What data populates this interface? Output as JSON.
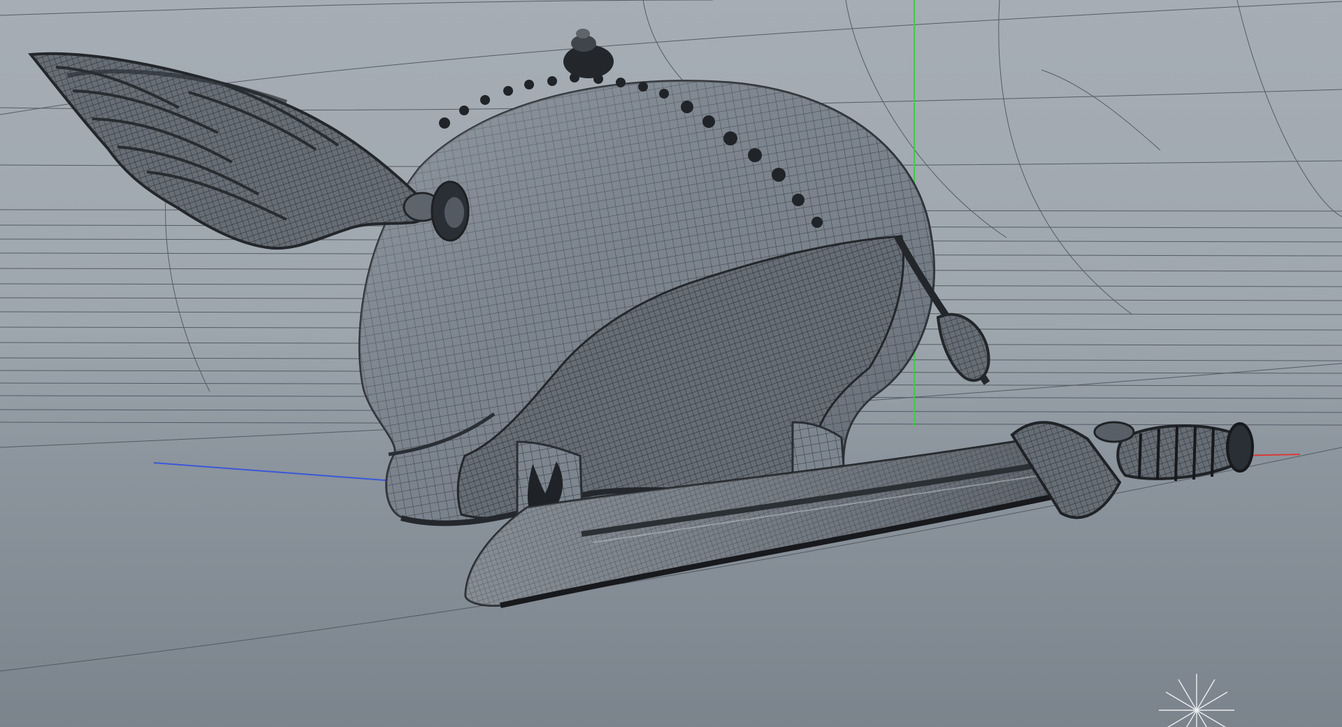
{
  "viewport": {
    "background_top": "#a6adb5",
    "background_bottom": "#7b838c",
    "axis_colors": {
      "y": "#41c94b",
      "x": "#d63b3b",
      "z": "#3a58d8"
    },
    "objects": [
      "winged-helmet",
      "sword"
    ],
    "icons": [
      "starburst-icon"
    ]
  }
}
